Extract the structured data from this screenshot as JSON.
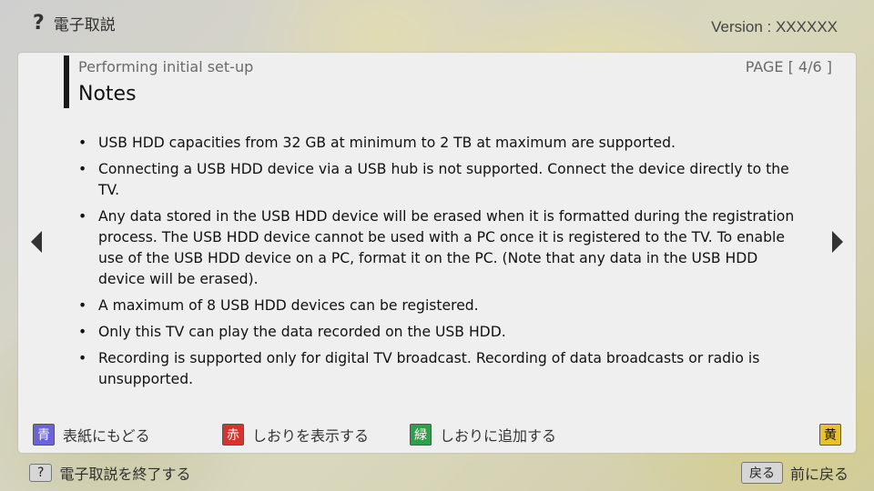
{
  "header": {
    "help_glyph": "?",
    "help_label": "電子取説",
    "version": "Version : XXXXXX"
  },
  "panel": {
    "subtitle": "Performing initial set-up",
    "title": "Notes",
    "page": "PAGE [ 4/6 ]",
    "notes": [
      "USB HDD capacities from 32 GB at minimum to 2 TB at maximum are supported.",
      "Connecting a USB HDD device via a USB hub is not supported. Connect the device directly to the TV.",
      "Any data stored in the USB HDD device will be erased when it is formatted during the registration process. The USB HDD device cannot be used with a PC once it is registered to the TV. To enable use of the USB HDD device on a PC, format it on the PC. (Note that any data in the USB HDD device will be erased).",
      "A maximum of 8 USB HDD devices can be registered.",
      "Only this TV can play the data recorded on the USB HDD.",
      "Recording is supported only for digital TV broadcast. Recording of data broadcasts or radio is unsupported."
    ]
  },
  "color_keys": {
    "blue": {
      "badge": "青",
      "label": "表紙にもどる"
    },
    "red": {
      "badge": "赤",
      "label": "しおりを表示する"
    },
    "green": {
      "badge": "緑",
      "label": "しおりに追加する"
    },
    "yellow": {
      "badge": "黄"
    }
  },
  "footer": {
    "help_key": "?",
    "help_label": "電子取説を終了する",
    "back_key": "戻る",
    "back_label": "前に戻る"
  },
  "icons": {
    "prev": "triangle-left-icon",
    "next": "triangle-right-icon"
  },
  "colors": {
    "blue": "#6b63d8",
    "red": "#d8322c",
    "green": "#2fa04a",
    "yellow": "#e9c12b"
  }
}
